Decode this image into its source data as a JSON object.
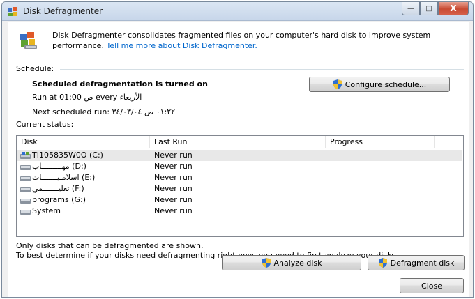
{
  "window": {
    "title": "Disk Defragmenter",
    "controls": {
      "minimize": "—",
      "maximize": "□",
      "close": "X"
    }
  },
  "intro": {
    "text": "Disk Defragmenter consolidates fragmented files on your computer's hard disk to improve system performance.",
    "link": "Tell me more about Disk Defragmenter."
  },
  "schedule": {
    "label": "Schedule:",
    "status": "Scheduled defragmentation is turned on",
    "run_at": "Run at 01:00 ص every الأربعاء",
    "next_run": "Next scheduled run: ٠١:٢٢ ص ٣٤/٠٣/٠٤",
    "configure_button": "Configure schedule..."
  },
  "current_status": {
    "label": "Current status:",
    "columns": [
      "Disk",
      "Last Run",
      "Progress"
    ],
    "rows": [
      {
        "disk": "TI105835W0O (C:)",
        "last_run": "Never run",
        "progress": "",
        "icon": "system-drive-icon"
      },
      {
        "disk": "مهـــــــــاب (D:)",
        "last_run": "Never run",
        "progress": "",
        "icon": "drive-icon"
      },
      {
        "disk": "اسلامـيـــــــات (E:)",
        "last_run": "Never run",
        "progress": "",
        "icon": "drive-icon"
      },
      {
        "disk": "تعليـــــــمي (F:)",
        "last_run": "Never run",
        "progress": "",
        "icon": "drive-icon"
      },
      {
        "disk": "programs (G:)",
        "last_run": "Never run",
        "progress": "",
        "icon": "drive-icon"
      },
      {
        "disk": "System",
        "last_run": "Never run",
        "progress": "",
        "icon": "drive-icon"
      }
    ]
  },
  "notes": {
    "line1": "Only disks that can be defragmented are shown.",
    "line2": "To best determine if your disks need defragmenting right now, you need to first analyze your disks."
  },
  "buttons": {
    "analyze": "Analyze disk",
    "defragment": "Defragment disk",
    "close": "Close"
  }
}
